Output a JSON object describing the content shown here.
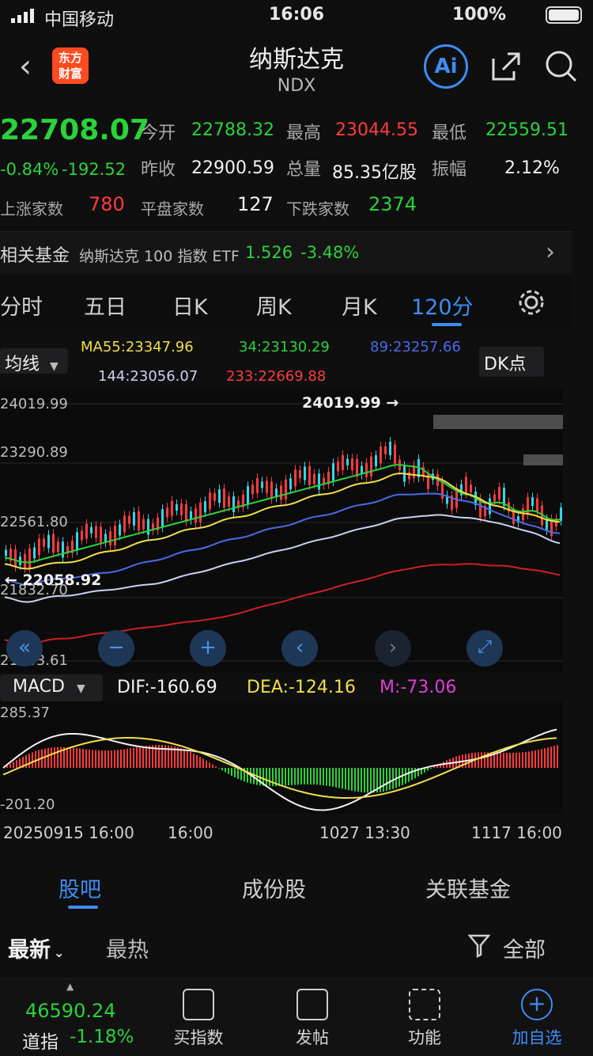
{
  "status": {
    "carrier": "中国移动",
    "time": "16:06",
    "battery": "100%"
  },
  "header": {
    "title": "纳斯达克",
    "code": "NDX",
    "logo_line1": "东方",
    "logo_line2": "财富",
    "ai_label": "Ai"
  },
  "quote": {
    "price": "22708.07",
    "change_pct": "-0.84%",
    "change": "-192.52",
    "rows": [
      {
        "l1": "今开",
        "v1": "22788.32",
        "l2": "最高",
        "v2": "23044.55",
        "l3": "最低",
        "v3": "22559.51"
      },
      {
        "l1": "昨收",
        "v1": "22900.59",
        "l2": "总量",
        "v2": "85.35亿股",
        "l3": "振幅",
        "v3": "2.12%"
      }
    ],
    "breadth": {
      "up_label": "上涨家数",
      "up": "780",
      "flat_label": "平盘家数",
      "flat": "127",
      "down_label": "下跌家数",
      "down": "2374"
    }
  },
  "fund": {
    "label": "相关基金",
    "name": "纳斯达克 100 指数 ETF",
    "price": "1.526",
    "change": "-3.48%"
  },
  "tabs": [
    "分时",
    "五日",
    "日K",
    "周K",
    "月K",
    "120分"
  ],
  "ma": {
    "selector": "均线",
    "ma55": "MA55:23347.96",
    "ma34": "34:23130.29",
    "ma89": "89:23257.66",
    "ma144": "144:23056.07",
    "ma233": "233:22669.88",
    "dk": "DK点"
  },
  "price_axis": [
    "24019.99",
    "23290.89",
    "22561.80",
    "21832.70",
    "21103.61"
  ],
  "annotations": {
    "high": "24019.99",
    "low": "22058.92"
  },
  "macd": {
    "selector": "MACD",
    "dif": "DIF:-160.69",
    "dea": "DEA:-124.16",
    "m": "M:-73.06",
    "top": "285.37",
    "bottom": "-201.20"
  },
  "time_axis": [
    "20250915 16:00",
    "16:00",
    "1027 13:30",
    "1117 16:00"
  ],
  "colors": {
    "up": "#ff3b3b",
    "down": "#2bd23b",
    "accent": "#3e8df3"
  },
  "bottom_tabs": [
    "股吧",
    "成份股",
    "关联基金"
  ],
  "feed_tabs": {
    "latest": "最新",
    "hot": "最热",
    "filter": "全部"
  },
  "bottom_nav": {
    "dow_price": "46590.24",
    "dow_label": "道指",
    "dow_change": "-1.18%",
    "items": [
      "买指数",
      "发帖",
      "功能",
      "加自选"
    ]
  }
}
